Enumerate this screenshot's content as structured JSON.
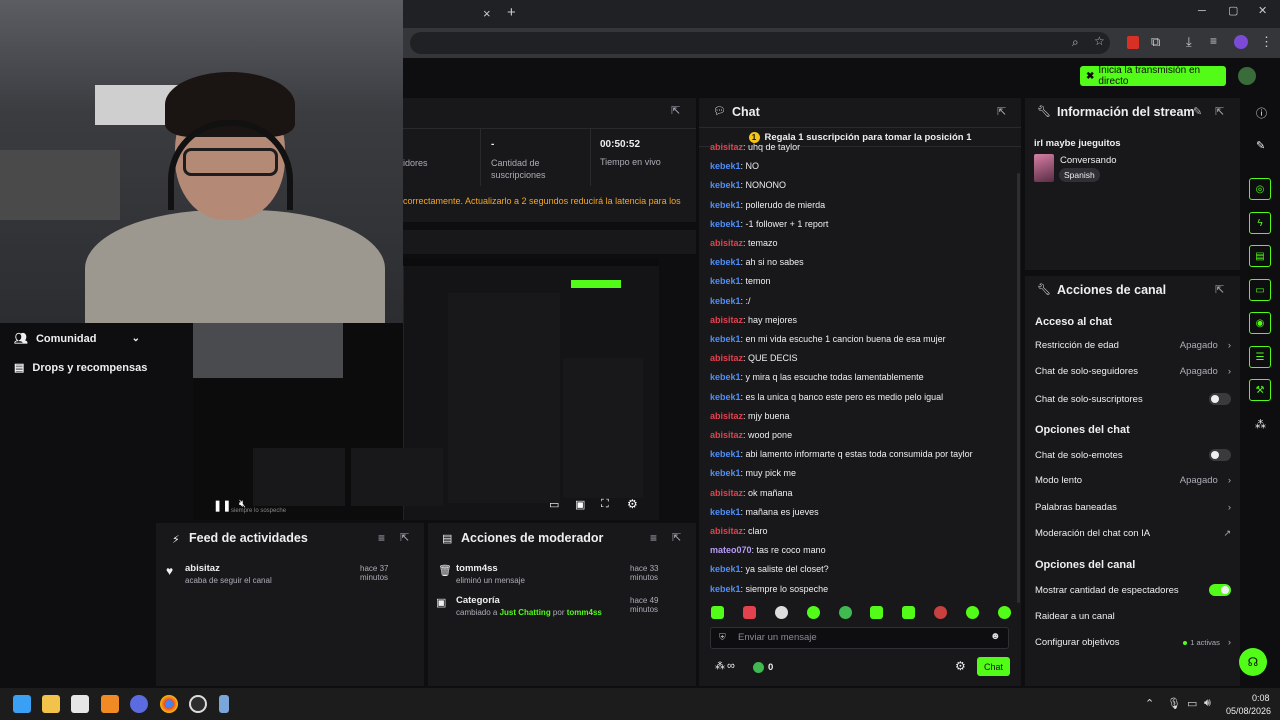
{
  "browser": {
    "tab_close": "×",
    "new_tab": "+",
    "window_controls": [
      "─",
      "▢",
      "✕"
    ]
  },
  "header": {
    "go_live_label": "Inicia la transmisión en directo"
  },
  "dashboard": {
    "stats": [
      {
        "value": "",
        "label": "idores"
      },
      {
        "value": "-",
        "label": "Cantidad de suscripciones"
      },
      {
        "value": "00:50:52",
        "label": "Tiempo en vivo"
      }
    ],
    "latency_warning": "correctamente. Actualizarlo a 2 segundos reducirá la latencia para los",
    "nav": [
      {
        "label": "Comunidad",
        "icon": "users-icon"
      },
      {
        "label": "Drops y recompensas",
        "icon": "gift-icon"
      }
    ],
    "preview_caption": "siempre lo sospeche"
  },
  "feed": {
    "title": "Feed de actividades",
    "items": [
      {
        "user": "abisitaz",
        "desc": "acaba de seguir el canal",
        "time": "hace 37 minutos"
      }
    ]
  },
  "mod": {
    "title": "Acciones de moderador",
    "items": [
      {
        "user": "tomm4ss",
        "desc": "eliminó un mensaje",
        "time": "hace 33 minutos"
      },
      {
        "title": "Categoría",
        "desc_prefix": "cambiado a ",
        "category": "Just Chatting",
        "desc_mid": " por ",
        "user": "tomm4ss",
        "time": "hace 49 minutos"
      }
    ]
  },
  "chat": {
    "title": "Chat",
    "sub_banner": "Regala 1 suscripción para tomar la posición 1",
    "messages": [
      {
        "user": "abisitaz",
        "text": "uhq de taylor",
        "color": "red"
      },
      {
        "user": "kebek1",
        "text": "NO",
        "color": "blue"
      },
      {
        "user": "kebek1",
        "text": "NONONO",
        "color": "blue"
      },
      {
        "user": "kebek1",
        "text": "pollerudo de mierda",
        "color": "blue"
      },
      {
        "user": "kebek1",
        "text": "-1 follower + 1 report",
        "color": "blue"
      },
      {
        "user": "abisitaz",
        "text": "temazo",
        "color": "red"
      },
      {
        "user": "kebek1",
        "text": "ah si no sabes",
        "color": "blue"
      },
      {
        "user": "kebek1",
        "text": "temon",
        "color": "blue"
      },
      {
        "user": "kebek1",
        "text": ":/",
        "color": "blue"
      },
      {
        "user": "abisitaz",
        "text": "hay mejores",
        "color": "red"
      },
      {
        "user": "kebek1",
        "text": "en mi vida escuche 1 cancion buena de esa mujer",
        "color": "blue"
      },
      {
        "user": "abisitaz",
        "text": "QUE DECIS",
        "color": "red"
      },
      {
        "user": "kebek1",
        "text": "y mira q las escuche todas lamentablemente",
        "color": "blue"
      },
      {
        "user": "kebek1",
        "text": "es la unica q banco este pero es medio pelo igual",
        "color": "blue"
      },
      {
        "user": "abisitaz",
        "text": "mjy buena",
        "color": "red"
      },
      {
        "user": "abisitaz",
        "text": "wood pone",
        "color": "red"
      },
      {
        "user": "kebek1",
        "text": "abi lamento informarte q estas toda consumida por taylor",
        "color": "blue"
      },
      {
        "user": "kebek1",
        "text": "muy pick me",
        "color": "blue"
      },
      {
        "user": "abisitaz",
        "text": "ok mañana",
        "color": "red"
      },
      {
        "user": "kebek1",
        "text": "mañana es jueves",
        "color": "blue"
      },
      {
        "user": "abisitaz",
        "text": "claro",
        "color": "red"
      },
      {
        "user": "mateo070",
        "text": "tas re coco mano",
        "color": "purple"
      },
      {
        "user": "kebek1",
        "text": "ya saliste del closet?",
        "color": "blue"
      },
      {
        "user": "kebek1",
        "text": "siempre lo sospeche",
        "color": "blue"
      }
    ],
    "input_placeholder": "Enviar un mensaje",
    "infinity": "∞",
    "points": "0",
    "send_label": "Chat"
  },
  "stream_info": {
    "title": "Información del stream",
    "stream_title": "irl maybe jueguitos",
    "category": "Conversando",
    "language": "Spanish"
  },
  "channel_actions": {
    "title": "Acciones de canal",
    "sections": {
      "chat_access": "Acceso al chat",
      "chat_options": "Opciones del chat",
      "channel_options": "Opciones del canal"
    },
    "rows": {
      "age": {
        "label": "Restricción de edad",
        "value": "Apagado"
      },
      "followers": {
        "label": "Chat de solo-seguidores",
        "value": "Apagado"
      },
      "subs": {
        "label": "Chat de solo-suscriptores"
      },
      "emotes": {
        "label": "Chat de solo-emotes"
      },
      "slow": {
        "label": "Modo lento",
        "value": "Apagado"
      },
      "banned": {
        "label": "Palabras baneadas"
      },
      "ai_mod": {
        "label": "Moderación del chat con IA"
      },
      "viewers": {
        "label": "Mostrar cantidad de espectadores"
      },
      "raid": {
        "label": "Raidear a un canal"
      },
      "goals": {
        "label": "Configurar objetivos",
        "value": "1 activas"
      }
    }
  },
  "taskbar": {
    "time": "0:08",
    "date": "05/08/2026"
  },
  "colors": {
    "accent": "#53fc18",
    "blue_user": "#4f8ef7",
    "red_user": "#e2414d",
    "purple_user": "#b79af5",
    "warning": "#f5a623"
  }
}
